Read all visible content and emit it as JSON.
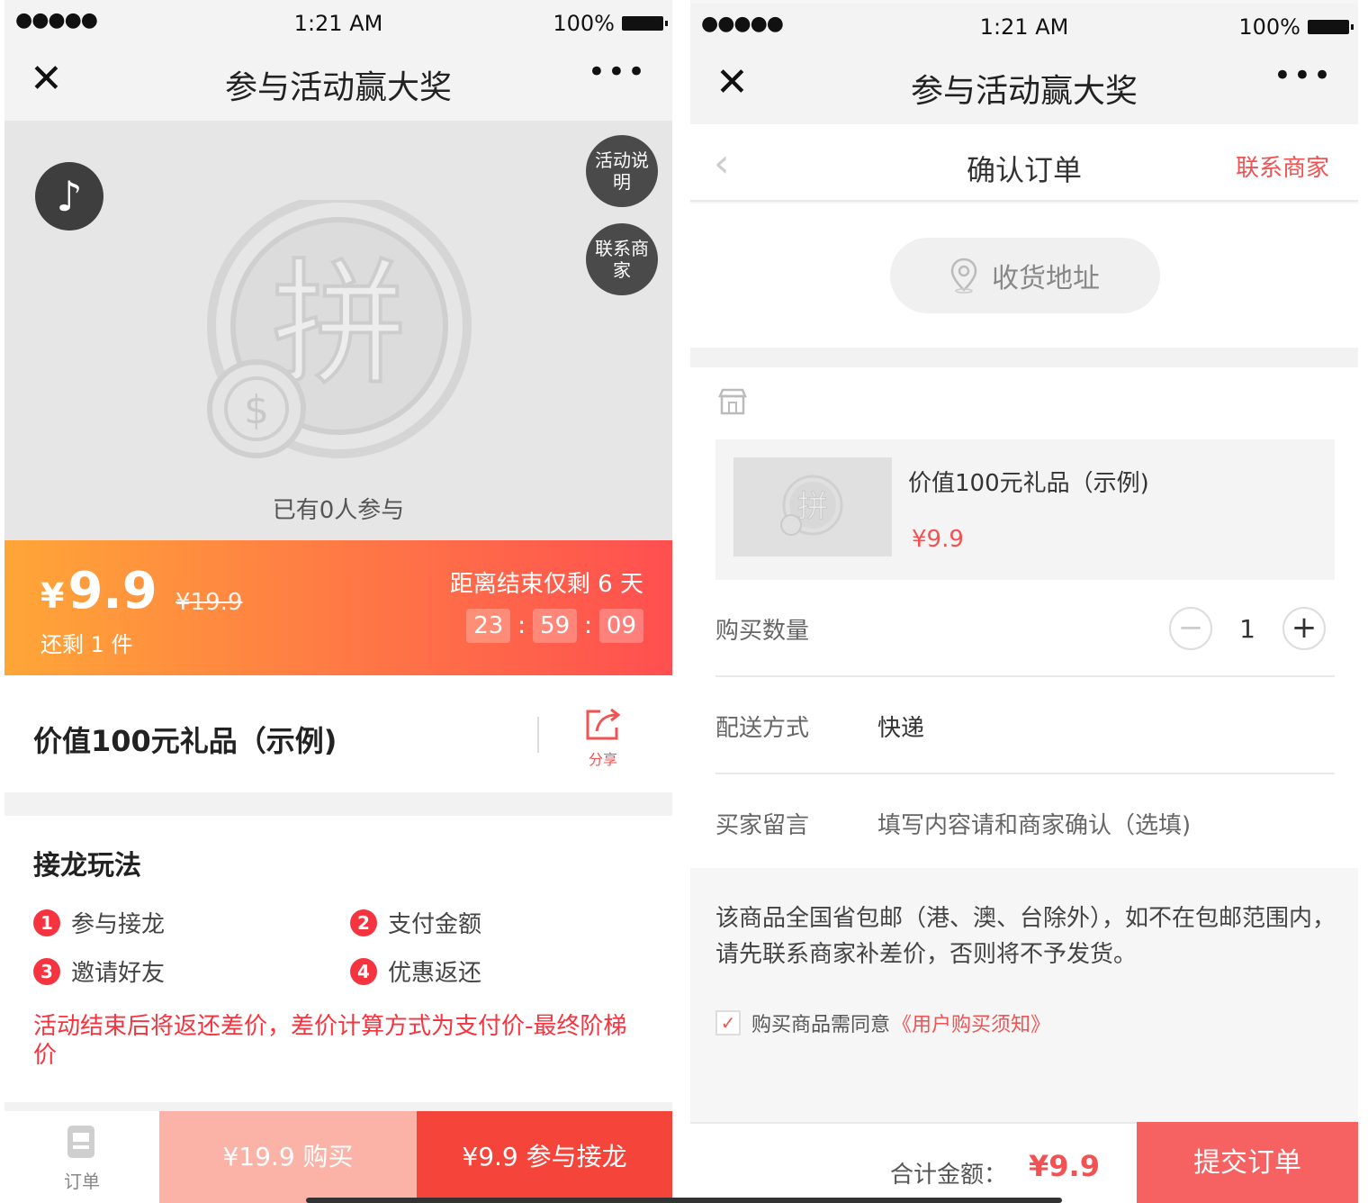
{
  "status_bar": {
    "signal": "●●●●●",
    "time": "1:21 AM",
    "battery": "100%"
  },
  "nav": {
    "close": "✕",
    "title": "参与活动赢大奖",
    "more": "•••"
  },
  "left": {
    "music_icon": "♪",
    "activity_info": "活动说明",
    "contact_seller": "联系商家",
    "placeholder_char": "拼",
    "joined_text": "已有0人参与",
    "price": {
      "currency": "¥",
      "value": "9.9",
      "original": "¥19.9",
      "stock": "还剩 1 件"
    },
    "countdown": {
      "label": "距离结束仅剩 6 天",
      "hours": "23",
      "minutes": "59",
      "seconds": "09",
      "sep": ":"
    },
    "product_title": "价值100元礼品（示例)",
    "share_label": "分享",
    "rules": {
      "heading": "接龙玩法",
      "steps": [
        {
          "num": "1",
          "label": "参与接龙"
        },
        {
          "num": "2",
          "label": "支付金额"
        },
        {
          "num": "3",
          "label": "邀请好友"
        },
        {
          "num": "4",
          "label": "优惠返还"
        }
      ],
      "note": "活动结束后将返还差价，差价计算方式为支付价-最终阶梯价"
    },
    "bottom": {
      "orders_label": "订单",
      "buy_original": "¥19.9 购买",
      "buy_join": "¥9.9 参与接龙"
    }
  },
  "right": {
    "header": {
      "back": "‹",
      "title": "确认订单",
      "contact": "联系商家"
    },
    "address_button": "收货地址",
    "item": {
      "placeholder_char": "拼",
      "name": "价值100元礼品（示例)",
      "price": "¥9.9"
    },
    "quantity": {
      "label": "购买数量",
      "minus": "−",
      "value": "1",
      "plus": "+"
    },
    "delivery": {
      "label": "配送方式",
      "value": "快递"
    },
    "message": {
      "label": "买家留言",
      "placeholder": "填写内容请和商家确认（选填)"
    },
    "notice": "该商品全国省包邮（港、澳、台除外），如不在包邮范围内，请先联系商家补差价，否则将不予发货。",
    "agree": {
      "check": "✓",
      "text": "购买商品需同意",
      "link": "《用户购买须知》"
    },
    "footer": {
      "total_label": "合计金额：",
      "total_value": "¥9.9",
      "submit": "提交订单"
    }
  },
  "colors": {
    "accent_red": "#f35252",
    "gradient_start": "#ffa637",
    "gradient_end": "#ff4f50",
    "submit": "#f66161"
  }
}
